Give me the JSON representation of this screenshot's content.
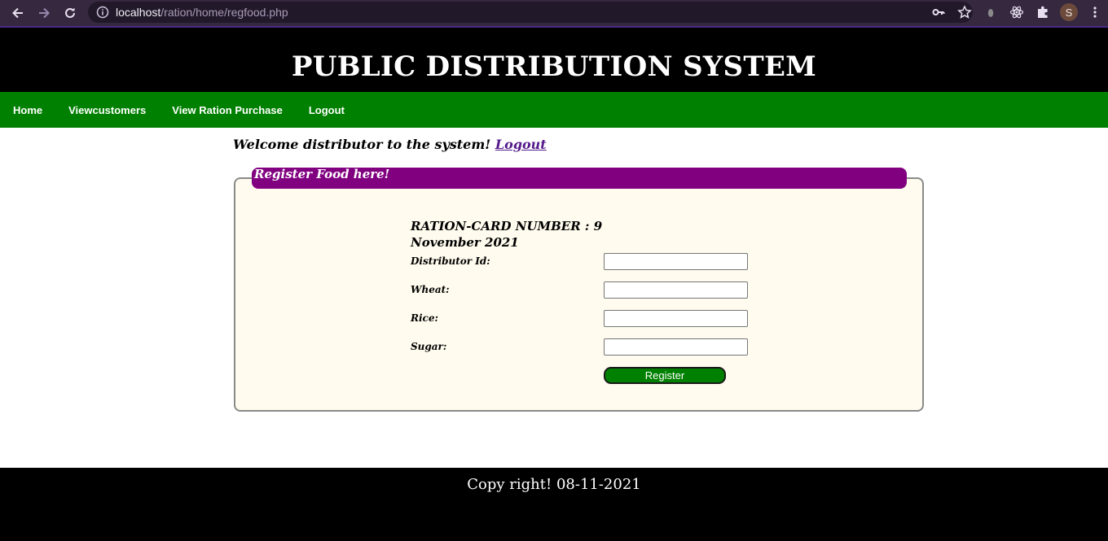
{
  "browser": {
    "url_host": "localhost",
    "url_path": "/ration/home/regfood.php",
    "avatar_letter": "S",
    "colors": {
      "frame": "#35283f",
      "omnibox": "#21182a"
    }
  },
  "header": {
    "title": "PUBLIC DISTRIBUTION SYSTEM",
    "colors": {
      "background": "#000000",
      "title": "#ffffff"
    }
  },
  "nav": {
    "items": [
      "Home",
      "Viewcustomers",
      "View Ration Purchase",
      "Logout"
    ],
    "colors": {
      "background": "#008000"
    }
  },
  "welcome": {
    "text": "Welcome distributor to the system!",
    "logout_link": "Logout"
  },
  "form": {
    "legend": "Register Food here!",
    "ration_card_line": "RATION-CARD NUMBER : 9",
    "month_line": "November 2021",
    "fields": [
      {
        "label": "Distributor Id:",
        "value": "",
        "placeholder": ""
      },
      {
        "label": "Wheat:",
        "value": "",
        "placeholder": ""
      },
      {
        "label": "Rice:",
        "value": "",
        "placeholder": ""
      },
      {
        "label": "Sugar:",
        "value": "",
        "placeholder": ""
      }
    ],
    "submit_label": "Register",
    "colors": {
      "legend_bg": "#800080",
      "panel_bg": "#fffbee",
      "button_bg": "#008000"
    }
  },
  "footer": {
    "text": "Copy right! 08-11-2021"
  }
}
